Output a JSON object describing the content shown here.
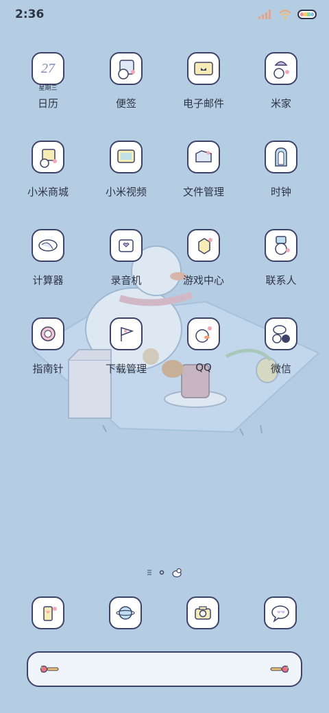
{
  "status_bar": {
    "time": "2:36",
    "icons": [
      "signal-icon",
      "wifi-icon",
      "battery-icon"
    ]
  },
  "apps": [
    {
      "label": "日历",
      "icon": "calendar-icon",
      "date_num": "27",
      "date_sub": "星期三"
    },
    {
      "label": "便签",
      "icon": "notes-icon"
    },
    {
      "label": "电子邮件",
      "icon": "email-icon"
    },
    {
      "label": "米家",
      "icon": "mijia-icon"
    },
    {
      "label": "小米商城",
      "icon": "mi-store-icon"
    },
    {
      "label": "小米视频",
      "icon": "mi-video-icon"
    },
    {
      "label": "文件管理",
      "icon": "file-manager-icon"
    },
    {
      "label": "时钟",
      "icon": "clock-icon"
    },
    {
      "label": "计算器",
      "icon": "calculator-icon"
    },
    {
      "label": "录音机",
      "icon": "recorder-icon"
    },
    {
      "label": "游戏中心",
      "icon": "game-center-icon"
    },
    {
      "label": "联系人",
      "icon": "contacts-icon"
    },
    {
      "label": "指南针",
      "icon": "compass-icon"
    },
    {
      "label": "下载管理",
      "icon": "downloads-icon"
    },
    {
      "label": "QQ",
      "icon": "qq-icon"
    },
    {
      "label": "微信",
      "icon": "wechat-icon"
    }
  ],
  "page_indicator": [
    "menu-lines-icon",
    "page-dot-icon",
    "duck-page-icon"
  ],
  "dock": [
    {
      "icon": "phone-icon"
    },
    {
      "icon": "browser-icon"
    },
    {
      "icon": "camera-icon"
    },
    {
      "icon": "messages-icon"
    }
  ],
  "search_bar": {
    "left_icon": "strawberry-icon",
    "right_icon": "strawberry-icon"
  },
  "colors": {
    "background": "#b4cde3",
    "outline": "#3d4268",
    "tile": "#ffffff"
  }
}
